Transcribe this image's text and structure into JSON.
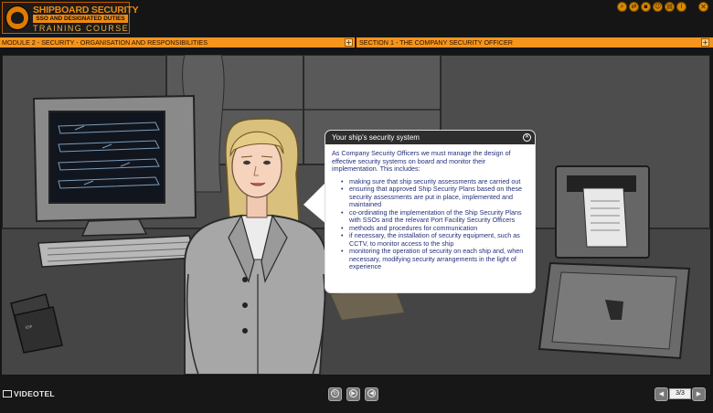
{
  "logo": {
    "title": "SHIPBOARD SECURITY",
    "subtitle": "SSO AND DESIGNATED DUTIES",
    "course": "TRAINING COURSE"
  },
  "window_controls": [
    {
      "name": "search-icon",
      "glyph": "⌕"
    },
    {
      "name": "share-icon",
      "glyph": "⇄"
    },
    {
      "name": "video-icon",
      "glyph": "▪"
    },
    {
      "name": "user-icon",
      "glyph": "☺"
    },
    {
      "name": "document-icon",
      "glyph": "▤"
    },
    {
      "name": "info-icon",
      "glyph": "i"
    },
    {
      "name": "close-icon",
      "glyph": "✕"
    }
  ],
  "module_bar": {
    "module_label": "MODULE 2 - SECURITY - ORGANISATION AND RESPONSIBILITIES",
    "section_label": "SECTION 1 - THE COMPANY SECURITY OFFICER",
    "expand_symbol": "+"
  },
  "bubble": {
    "title": "Your ship's security system",
    "close_glyph": "✕",
    "intro": "As Company Security Officers we must manage the design of effective security systems on board and monitor their implementation. This includes:",
    "bullets": [
      "making sure that ship security  assessments are carried out",
      "ensuring that approved Ship Security Plans based on these security assessments are put in place, implemented and maintained",
      "co-ordinating the implementation of the Ship Security Plans with SSOs and the relevant Port Facility Security Officers",
      "methods and procedures for communication",
      "if necessary, the installation of security equipment, such as CCTV, to monitor access to the ship",
      "monitoring the operation of security on each ship and, when necessary, modifying security arrangements in the light of experience"
    ]
  },
  "footer": {
    "brand": "VIDEOTEL",
    "media_buttons": [
      {
        "name": "replay-icon",
        "glyph": "↻"
      },
      {
        "name": "play-icon",
        "glyph": "▶"
      },
      {
        "name": "volume-icon",
        "glyph": "◀"
      }
    ],
    "prev_glyph": "◀",
    "next_glyph": "▶",
    "page_indicator": "3/3"
  },
  "colors": {
    "accent": "#f7941d",
    "bubble_header": "#2e2e2e",
    "bubble_text": "#24307a"
  }
}
